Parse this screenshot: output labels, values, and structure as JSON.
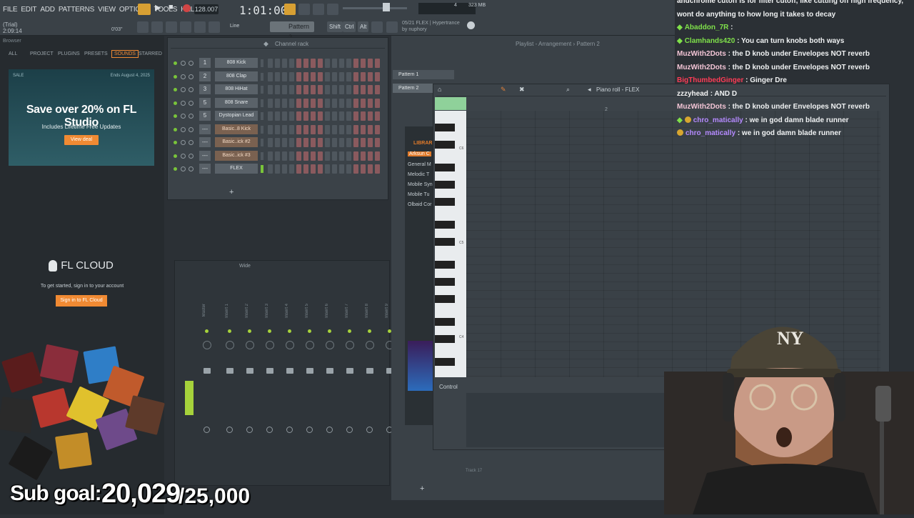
{
  "menu": [
    "FILE",
    "EDIT",
    "ADD",
    "PATTERNS",
    "VIEW",
    "OPTIONS",
    "TOOLS",
    "HELP"
  ],
  "transport": {
    "tempo": "128.007",
    "time": "1:01:00",
    "trial": "(Trial)",
    "elapsed": "2:09:14",
    "pos": "0'03\"",
    "pattern": "Pattern 2",
    "snap": "Line",
    "shift": "Shift",
    "ctrl": "Ctrl",
    "alt": "Alt",
    "cpu": "4",
    "mem": "323 MB"
  },
  "plugin_info": {
    "line1": "05/21 FLEX | Hypertrance",
    "line2": "by nuphory"
  },
  "browser": {
    "header": "Browser",
    "tabs": [
      "ALL",
      "PROJECT",
      "PLUGINS",
      "PRESETS",
      "SOUNDS",
      "STARRED"
    ],
    "active_tab": "SOUNDS",
    "promo": {
      "sale": "SALE",
      "ends": "Ends August 4, 2025",
      "title": "Save over 20% on FL Studio",
      "subtitle": "Includes Lifetime Free Updates",
      "button": "View deal"
    },
    "cloud": {
      "title": "FL CLOUD",
      "subtitle": "To get started, sign in to your account",
      "button": "Sign in to FL Cloud"
    }
  },
  "channel_rack": {
    "title": "Channel rack",
    "channels": [
      {
        "num": "1",
        "name": "808 Kick",
        "orange": false
      },
      {
        "num": "2",
        "name": "808 Clap",
        "orange": false
      },
      {
        "num": "3",
        "name": "808 HiHat",
        "orange": false
      },
      {
        "num": "5",
        "name": "808 Snare",
        "orange": false
      },
      {
        "num": "5",
        "name": "Dystopian Lead",
        "orange": false
      },
      {
        "num": "---",
        "name": "Basic..8 Kick",
        "orange": true
      },
      {
        "num": "---",
        "name": "Basic..ick #2",
        "orange": true
      },
      {
        "num": "---",
        "name": "Basic..ick #3",
        "orange": true
      },
      {
        "num": "---",
        "name": "FLEX",
        "orange": false
      }
    ]
  },
  "mixer": {
    "title": "Wide",
    "tracks": [
      "Master",
      "Insert 1",
      "Insert 2",
      "Insert 3",
      "Insert 4",
      "Insert 5",
      "Insert 6",
      "Insert 7",
      "Insert 8",
      "Insert 9"
    ]
  },
  "playlist": {
    "title": "Playlist - Arrangement › Pattern 2",
    "patterns": [
      "Pattern 1",
      "Pattern 2"
    ],
    "track_label": "Track 17"
  },
  "piano_roll": {
    "title": "Piano roll - FLEX",
    "control": "Control",
    "octaves": [
      "C6",
      "C5",
      "C4"
    ],
    "bar_marker": "2"
  },
  "library": {
    "title": "LIBRAR",
    "items": [
      "Arksun C",
      "General M",
      "Melodic T",
      "Mobile Syn",
      "Mobile Tu",
      "Olbaid Cor"
    ]
  },
  "chat": [
    {
      "user": "andchrome",
      "text": "cutoff is for filter cutoff, like cutting off high frequency,",
      "color": "u-white",
      "icon": ""
    },
    {
      "user": "",
      "text": "wont do anything to how long it takes to decay",
      "color": "u-white",
      "icon": ""
    },
    {
      "user": "Abaddon_7R",
      "text": ":",
      "color": "u-green",
      "icon": "sub"
    },
    {
      "user": "Clamhands420",
      "text": ": You can turn knobs both ways",
      "color": "u-green",
      "icon": "sub"
    },
    {
      "user": "MuzWith2Dots",
      "text": ": the D knob under Envelopes NOT reverb",
      "color": "u-pink",
      "icon": ""
    },
    {
      "user": "MuzWith2Dots",
      "text": ": the D knob under Envelopes NOT reverb",
      "color": "u-pink",
      "icon": ""
    },
    {
      "user": "BigThumbedGinger",
      "text": ": Ginger Dre",
      "color": "u-red",
      "icon": ""
    },
    {
      "user": "zzzyhead",
      "text": ": AND D",
      "color": "u-white",
      "icon": ""
    },
    {
      "user": "MuzWith2Dots",
      "text": ": the D knob under Envelopes NOT reverb",
      "color": "u-pink",
      "icon": ""
    },
    {
      "user": "chro_matically",
      "text": ": we in god damn blade runner",
      "color": "u-purple",
      "icon": "sub-badge"
    },
    {
      "user": "chro_matically",
      "text": ": we in god damn blade runner",
      "color": "u-purple",
      "icon": "badge"
    }
  ],
  "subgoal": {
    "label": "Sub goal:",
    "current": "20,029",
    "target": "/25,000"
  },
  "colors": {
    "accent": "#f08a33",
    "sub": "#7fe04a",
    "bg": "#2b3035"
  }
}
